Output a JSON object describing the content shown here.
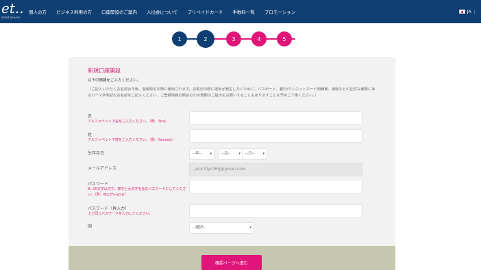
{
  "logo": {
    "text": "et..",
    "tagline": "ilated Service"
  },
  "nav": {
    "items": [
      "個人の方",
      "ビジネス利用の方",
      "口座開設のご案内",
      "入出金について",
      "プリペイドカード",
      "手数料一覧",
      "プロモーション"
    ],
    "lang": "JA",
    "lang_sep": "|"
  },
  "steps": [
    "1",
    "2",
    "3",
    "4",
    "5"
  ],
  "step_colors": {
    "done": "#0f3e72",
    "pending": "#e0157a"
  },
  "form": {
    "title": "新規口座開設",
    "subtitle": "以下の情報をご入力ください。",
    "note": "（ご記入いただくお名前は今後、金融取引の際に使用されます。お取引の際に違反が発生しないために、パスポート、銀行/クレジットカード明細書、運転などの正式な書類にあるローマ字表記のお名前をご記入ください。ご登録情報の照合のため書類のご提出をお願いすることもありますことを予めご了承ください。）",
    "first_name": {
      "label": "名",
      "hint": "アルファベットで名をご入力ください。（例：Taro）"
    },
    "last_name": {
      "label": "姓",
      "hint": "アルファベットで姓をご入力ください。（例：Yamada）"
    },
    "dob": {
      "label": "生年月日",
      "year": "--年--",
      "month": "--月--",
      "day": "--日--"
    },
    "email": {
      "label": "メールアドレス",
      "value": "jack.lilyc36g@gmail.com"
    },
    "password": {
      "label": "パスワード",
      "hint": "8~20文字以内で、数字と大文字を含むパスワードにしてください。（例：AbcZ%-go-p）"
    },
    "password_confirm": {
      "label": "パスワード（再入力）",
      "hint": "上と同じパスワードを入力してください。"
    },
    "country": {
      "label": "国",
      "placeholder": "--選択--"
    },
    "submit": "確認ページへ進む"
  }
}
